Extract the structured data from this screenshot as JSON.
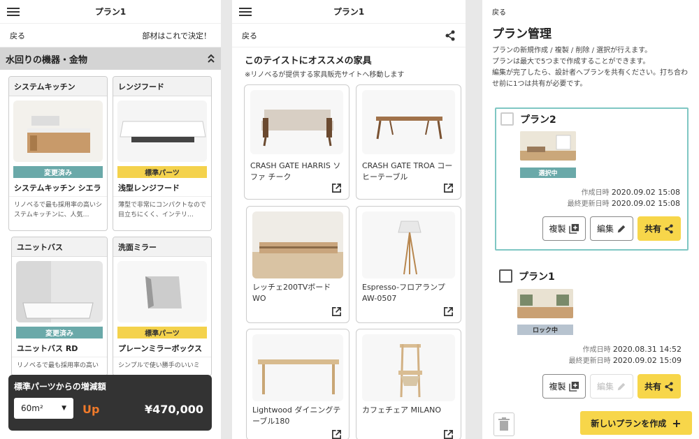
{
  "panel1": {
    "title": "プラン1",
    "back": "戻る",
    "confirm": "部材はこれで決定！",
    "section": "水回りの機器・金物",
    "items": [
      {
        "category": "システムキッチン",
        "badge": "変更済み",
        "name": "システムキッチン シエラ",
        "desc": "リノベるで最も採用率の高いシステムキッチンに、人気…"
      },
      {
        "category": "レンジフード",
        "badge": "標準パーツ",
        "name": "浅型レンジフード",
        "desc": "薄型で非常にコンパクトなので目立ちにくく、インテリ…"
      },
      {
        "category": "ユニットバス",
        "badge": "変更済み",
        "name": "ユニットバス RD",
        "desc": "リノベるで最も採用率の高い"
      },
      {
        "category": "洗面ミラー",
        "badge": "標準パーツ",
        "name": "プレーンミラーボックス",
        "desc": "シンプルで使い勝手のいいミ"
      }
    ],
    "overlay": {
      "title": "標準パーツからの増減額",
      "select": "60m²",
      "direction": "Up",
      "price": "¥470,000"
    }
  },
  "panel2": {
    "title": "プラン1",
    "back": "戻る",
    "heading": "このテイストにオススメの家具",
    "note": "※リノベるが提供する家具販売サイトへ移動します",
    "items": [
      {
        "name": "CRASH GATE HARRIS ソファ チーク"
      },
      {
        "name": "CRASH GATE TROA コーヒーテーブル"
      },
      {
        "name": "レッチェ200TVボード WO"
      },
      {
        "name": "Espresso-フロアランプ AW-0507"
      },
      {
        "name": "Lightwood ダイニングテーブル180"
      },
      {
        "name": "カフェチェア MILANO"
      }
    ]
  },
  "panel3": {
    "back": "戻る",
    "title": "プラン管理",
    "desc": [
      "プランの新規作成 / 複製 / 削除 / 選択が行えます。",
      "プランは最大で5つまで作成することができます。",
      "編集が完了したら、設計者へプランを共有ください。打ち合わせ前に1つは共有が必要です。"
    ],
    "plans": [
      {
        "name": "プラン2",
        "status": "選択中",
        "created_label": "作成日時",
        "created": "2020.09.02 15:08",
        "updated_label": "最終更新日時",
        "updated": "2020.09.02 15:08"
      },
      {
        "name": "プラン1",
        "status": "ロック中",
        "created_label": "作成日時",
        "created": "2020.08.31 14:52",
        "updated_label": "最終更新日時",
        "updated": "2020.09.02 15:09"
      }
    ],
    "buttons": {
      "duplicate": "複製",
      "edit": "編集",
      "share": "共有"
    },
    "new_plan": "新しいプランを作成",
    "colors": {
      "teal": "#6aa9a9",
      "yellow": "#f7d64a",
      "accent": "#f07a2a"
    }
  }
}
